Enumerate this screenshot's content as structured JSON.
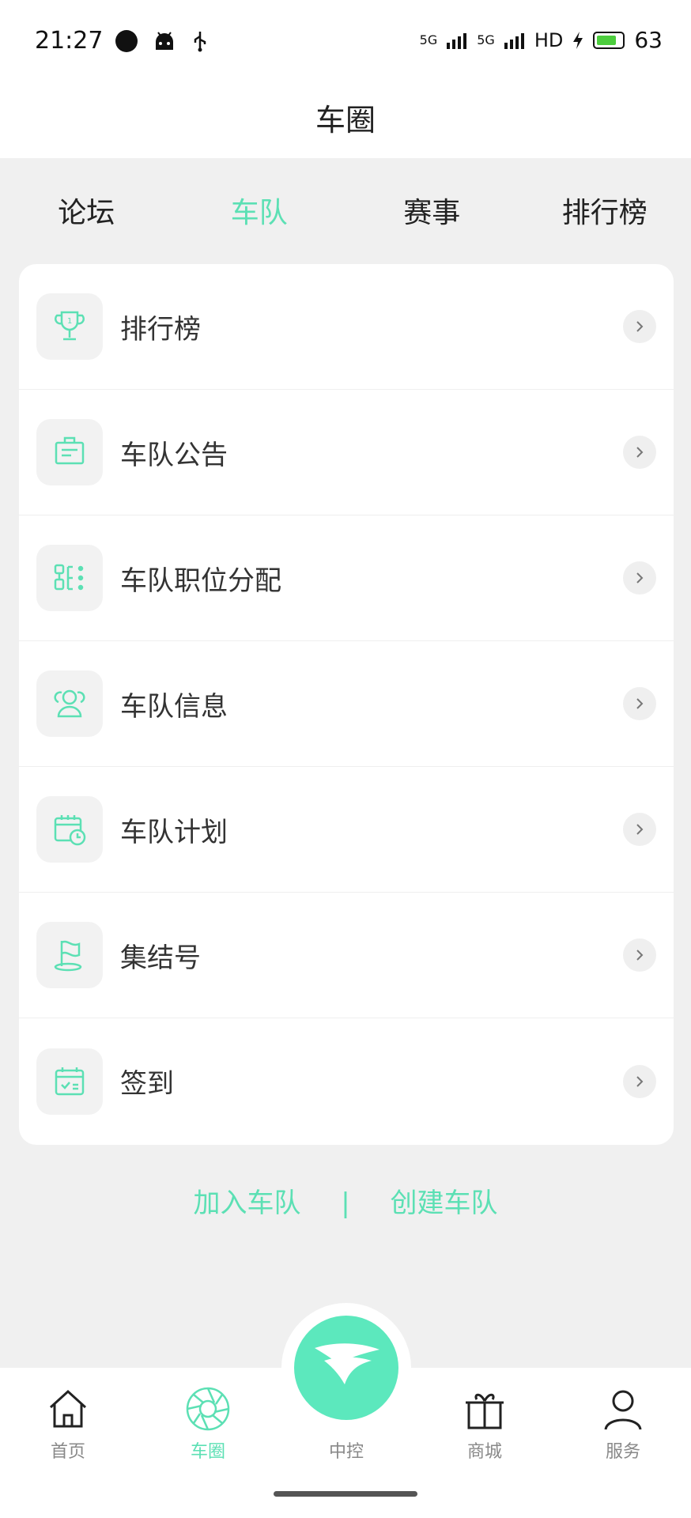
{
  "status_bar": {
    "time": "21:27",
    "network": "5G",
    "hd": "HD",
    "battery": "63"
  },
  "header": {
    "title": "车圈"
  },
  "tabs": [
    {
      "label": "论坛"
    },
    {
      "label": "车队"
    },
    {
      "label": "赛事"
    },
    {
      "label": "排行榜"
    }
  ],
  "active_tab": "车队",
  "menu": [
    {
      "label": "排行榜",
      "icon": "trophy-icon"
    },
    {
      "label": "车队公告",
      "icon": "notice-board-icon"
    },
    {
      "label": "车队职位分配",
      "icon": "org-chart-icon"
    },
    {
      "label": "车队信息",
      "icon": "team-users-icon"
    },
    {
      "label": "车队计划",
      "icon": "calendar-clock-icon"
    },
    {
      "label": "集结号",
      "icon": "flag-icon"
    },
    {
      "label": "签到",
      "icon": "checkin-calendar-icon"
    }
  ],
  "actions": {
    "join": "加入车队",
    "separator": "|",
    "create": "创建车队"
  },
  "bottom_nav": [
    {
      "label": "首页",
      "icon": "home-icon"
    },
    {
      "label": "车圈",
      "icon": "aperture-icon"
    },
    {
      "label": "中控",
      "icon": "control-logo-icon"
    },
    {
      "label": "商城",
      "icon": "gift-icon"
    },
    {
      "label": "服务",
      "icon": "person-icon"
    }
  ],
  "colors": {
    "accent": "#5ce0b4",
    "background": "#f0f0f0"
  }
}
